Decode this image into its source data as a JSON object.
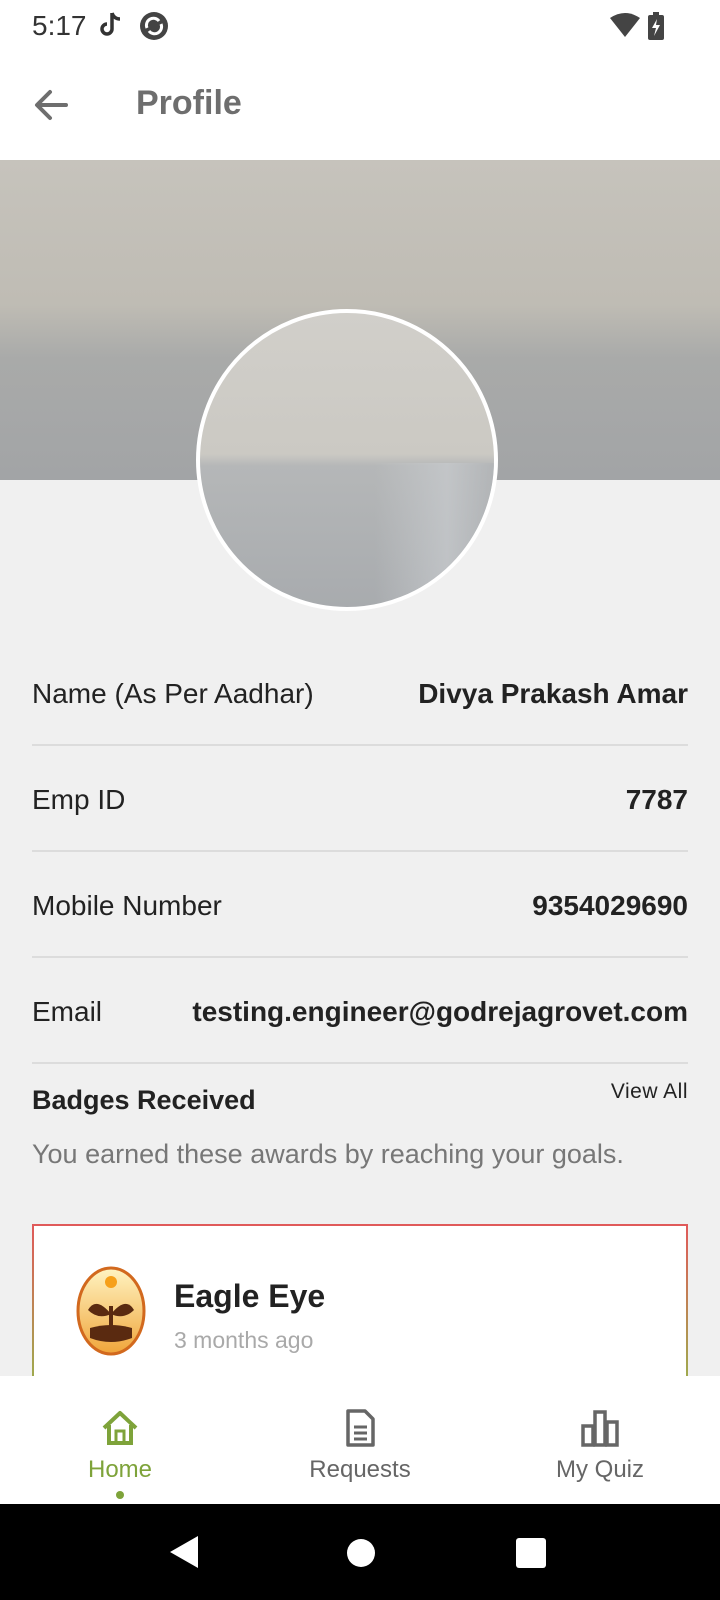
{
  "status_bar": {
    "time": "5:17"
  },
  "header": {
    "title": "Profile"
  },
  "profile": {
    "fields": [
      {
        "label": "Name (As Per Aadhar)",
        "value": "Divya Prakash Amar"
      },
      {
        "label": "Emp ID",
        "value": "7787"
      },
      {
        "label": "Mobile Number",
        "value": "9354029690"
      },
      {
        "label": "Email",
        "value": "testing.engineer@godrejagrovet.com"
      }
    ]
  },
  "badges": {
    "title": "Badges Received",
    "view_all": "View All",
    "subtitle": "You earned these awards by reaching your goals.",
    "items": [
      {
        "name": "Eagle Eye",
        "time": "3 months ago"
      }
    ]
  },
  "bottom_nav": {
    "items": [
      {
        "label": "Home",
        "icon": "home-icon",
        "active": true
      },
      {
        "label": "Requests",
        "icon": "document-icon",
        "active": false
      },
      {
        "label": "My Quiz",
        "icon": "bar-chart-icon",
        "active": false
      }
    ]
  },
  "colors": {
    "accent": "#7ea33a",
    "card_border_top": "#e05a5a",
    "card_border_bottom": "#8bc34a"
  }
}
